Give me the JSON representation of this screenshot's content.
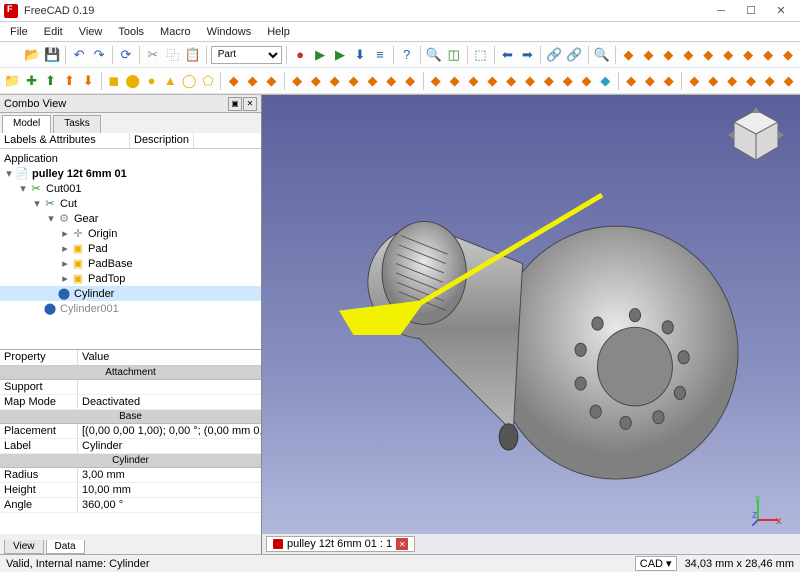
{
  "window": {
    "title": "FreeCAD 0.19"
  },
  "menu": [
    "File",
    "Edit",
    "View",
    "Tools",
    "Macro",
    "Windows",
    "Help"
  ],
  "workbench": {
    "selected": "Part"
  },
  "combo": {
    "title": "Combo View",
    "tabs": [
      "Model",
      "Tasks"
    ],
    "activeTab": 0,
    "cols": {
      "labels": "Labels & Attributes",
      "desc": "Description"
    },
    "bottomTabs": [
      "View",
      "Data"
    ],
    "activeBottom": 1
  },
  "tree": {
    "root": "Application",
    "nodes": [
      {
        "indent": 0,
        "tw": "▾",
        "icon": "doc",
        "label": "pulley 12t 6mm 01",
        "bold": true
      },
      {
        "indent": 1,
        "tw": "▾",
        "icon": "cut",
        "label": "Cut001"
      },
      {
        "indent": 2,
        "tw": "▾",
        "icon": "cut",
        "label": "Cut"
      },
      {
        "indent": 3,
        "tw": "▾",
        "icon": "body",
        "label": "Gear"
      },
      {
        "indent": 4,
        "tw": "▸",
        "icon": "origin",
        "label": "Origin"
      },
      {
        "indent": 4,
        "tw": "▸",
        "icon": "pad",
        "label": "Pad"
      },
      {
        "indent": 4,
        "tw": "▸",
        "icon": "pad",
        "label": "PadBase"
      },
      {
        "indent": 4,
        "tw": "▸",
        "icon": "pad",
        "label": "PadTop"
      },
      {
        "indent": 3,
        "tw": "",
        "icon": "cyl",
        "label": "Cylinder",
        "selected": true
      },
      {
        "indent": 2,
        "tw": "",
        "icon": "cyl",
        "label": "Cylinder001",
        "grey": true
      }
    ]
  },
  "properties": {
    "cols": {
      "prop": "Property",
      "val": "Value"
    },
    "groups": [
      {
        "name": "Attachment",
        "rows": [
          {
            "k": "Support",
            "v": ""
          },
          {
            "k": "Map Mode",
            "v": "Deactivated"
          }
        ]
      },
      {
        "name": "Base",
        "rows": [
          {
            "k": "Placement",
            "v": "[(0,00 0,00 1,00); 0,00 °; (0,00 mm 0,00 mm 0,0…"
          },
          {
            "k": "Label",
            "v": "Cylinder"
          }
        ]
      },
      {
        "name": "Cylinder",
        "rows": [
          {
            "k": "Radius",
            "v": "3,00 mm"
          },
          {
            "k": "Height",
            "v": "10,00 mm"
          },
          {
            "k": "Angle",
            "v": "360,00 °"
          }
        ]
      }
    ]
  },
  "docTab": {
    "label": "pulley 12t 6mm 01 : 1"
  },
  "status": {
    "left": "Valid, Internal name: Cylinder",
    "cad": "CAD",
    "dims": "34,03 mm x 28,46 mm"
  },
  "colors": {
    "red": "#c03030",
    "green": "#2a8a2a",
    "blue": "#2a5fb0",
    "yellow": "#e8b000",
    "orange": "#e07000",
    "cyan": "#2aa0c0",
    "purple": "#7050a0",
    "grey": "#808080"
  },
  "toolbar_rows": [
    [
      "new",
      "open",
      "save",
      "sep",
      "undo",
      "redo",
      "sep",
      "refresh",
      "sep",
      "cut",
      "copy",
      "paste",
      "sep",
      "wbselect",
      "sep",
      "rec",
      "stop",
      "play",
      "debug",
      "macros",
      "sep",
      "whatsthis",
      "sep",
      "magnify",
      "box",
      "sep",
      "cube-sync",
      "sep",
      "l-arrow",
      "r-arrow",
      "sep",
      "link1",
      "link2",
      "sep",
      "m-blue",
      "sep",
      "b1",
      "b2",
      "b3",
      "b4",
      "b5",
      "b6",
      "b7",
      "b8",
      "b9"
    ],
    [
      "folder",
      "new2",
      "na",
      "export",
      "import",
      "sep",
      "s-cube",
      "s-cyl",
      "s-sph",
      "s-cone",
      "s-tor",
      "s-prism",
      "sep",
      "c1",
      "c2",
      "c3",
      "sep",
      "f0",
      "f1",
      "f2",
      "f3",
      "f4",
      "f5",
      "f6",
      "sep",
      "g1",
      "g2",
      "g3",
      "g4",
      "g5",
      "g6",
      "g7",
      "g8",
      "g9",
      "g10",
      "sep",
      "h1",
      "h2",
      "h3",
      "sep",
      "i1",
      "i2",
      "i3",
      "i4",
      "i5",
      "i6"
    ]
  ]
}
